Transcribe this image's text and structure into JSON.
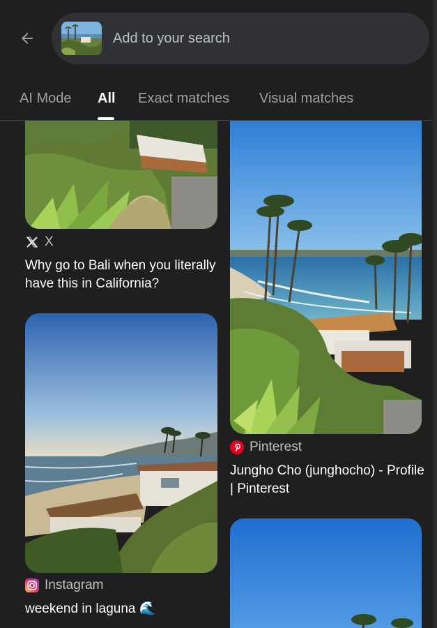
{
  "header": {
    "back_icon": "arrow-left-icon",
    "search_placeholder": "Add to your search"
  },
  "tabs": [
    {
      "label": "AI Mode",
      "active": false
    },
    {
      "label": "All",
      "active": true
    },
    {
      "label": "Exact matches",
      "active": false
    },
    {
      "label": "Visual matches",
      "active": false
    }
  ],
  "results": [
    {
      "source": "X",
      "source_icon": "x-logo-icon",
      "title": "Why go to Bali when you literally have this in California?"
    },
    {
      "source": "Pinterest",
      "source_icon": "pinterest-logo-icon",
      "title": "Jungho Cho (junghocho) - Profile | Pinterest"
    },
    {
      "source": "Instagram",
      "source_icon": "instagram-logo-icon",
      "title": "weekend in laguna 🌊"
    }
  ],
  "colors": {
    "background": "#1f1f1f",
    "search_pill": "#303134",
    "pinterest_red": "#e60023",
    "text_primary": "#ffffff",
    "text_secondary": "#9aa0a6"
  }
}
